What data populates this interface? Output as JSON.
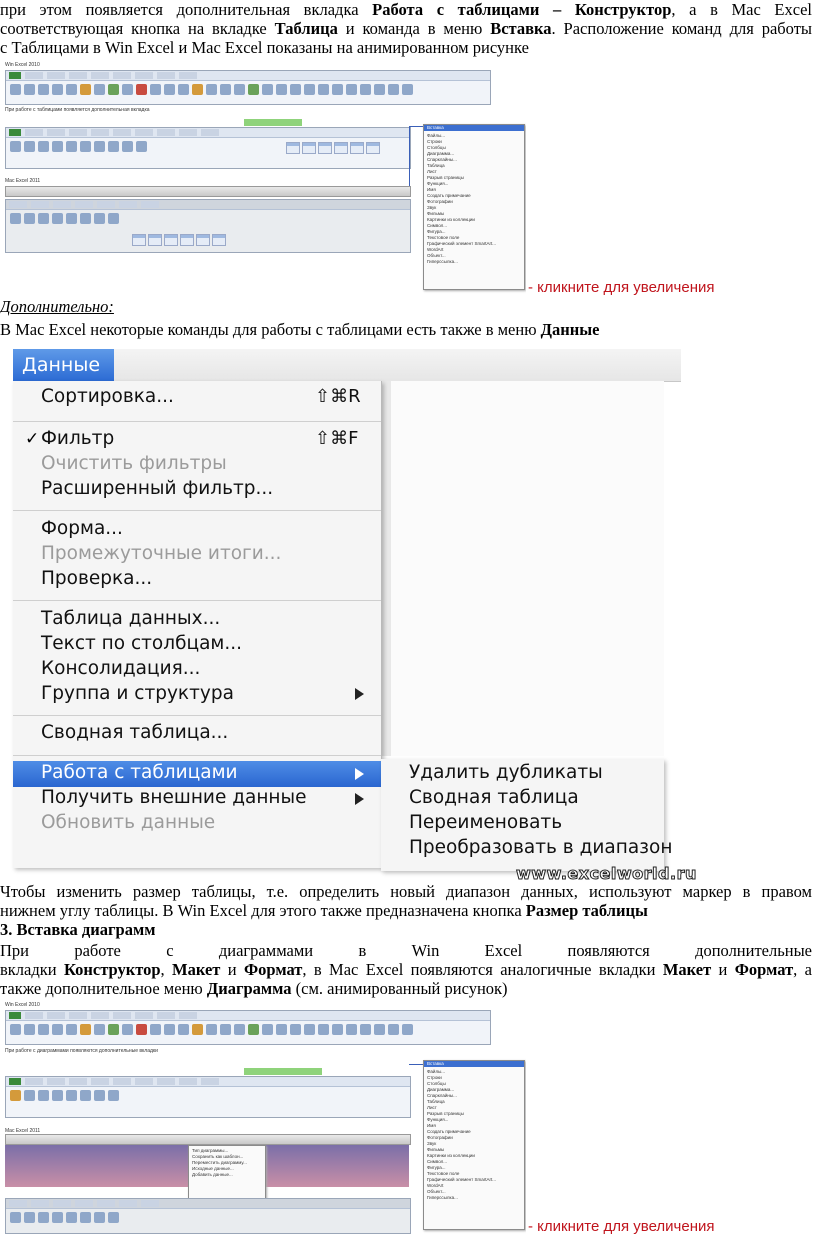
{
  "para1": {
    "line1": [
      "при этом появляется дополнительная вкладка ",
      "Работа с таблицами – Конструктор",
      ", а в Mac Excel"
    ],
    "line2": [
      "соответствующая кнопка на вкладке ",
      "Таблица",
      " и команда в меню ",
      "Вставка",
      ". Расположение команд для работы"
    ],
    "line3": "с Таблицами в Win Excel и Mac Excel показаны на анимированном рисунке"
  },
  "thumb1": {
    "win_label": "Win Excel 2010",
    "caption": "При работе с таблицами появляется дополнительная вкладка",
    "mac_label": "Mac Excel 2011",
    "mac_menu_title": "Вставка",
    "mac_menu_items": [
      "Файлы...",
      "Строки",
      "Столбцы",
      "Диаграмма...",
      "Спарклайны...",
      "Таблица",
      "Лист",
      "Разрыв страницы",
      "Функция...",
      "Имя",
      "Создать примечание",
      "Фотографии",
      "Звук",
      "Фильмы",
      "Картинки из коллекции",
      "Символ...",
      "Фигура...",
      "Текстовое поле",
      "Графический элемент SmartArt...",
      "WordArt",
      "Объект...",
      "Гиперссылка..."
    ],
    "click_link": "кликните для увеличения"
  },
  "dop_heading": "Дополнительно:",
  "para2": [
    "В Mac Excel некоторые команды для работы с таблицами есть также в меню ",
    "Данные"
  ],
  "menu": {
    "title": "Данные",
    "items": {
      "sort": "Сортировка...",
      "sort_shortcut": "⇧⌘R",
      "filter": "Фильтр",
      "filter_check": "✓",
      "filter_shortcut": "⇧⌘F",
      "clear_filters": "Очистить фильтры",
      "adv_filter": "Расширенный фильтр...",
      "form": "Форма...",
      "subtotals": "Промежуточные итоги...",
      "validation": "Проверка...",
      "data_table": "Таблица данных...",
      "text_to_columns": "Текст по столбцам...",
      "consolidate": "Консолидация...",
      "group": "Группа и структура",
      "pivot": "Сводная таблица...",
      "table_tools": "Работа с таблицами",
      "external": "Получить внешние данные",
      "refresh": "Обновить данные"
    },
    "submenu": [
      "Удалить дубликаты",
      "Сводная таблица",
      "Переименовать",
      "Преобразовать в диапазон"
    ],
    "watermark": "www.excelworld.ru"
  },
  "para3": {
    "line1": "Чтобы изменить размер таблицы, т.е. определить новый диапазон данных, используют маркер в правом",
    "line2": [
      "нижнем углу таблицы. В Win Excel для этого также предназначена кнопка ",
      "Размер таблицы"
    ]
  },
  "section3": "3. Вставка диаграмм",
  "para4": {
    "line1": "При работе с диаграммами в Win Excel появляются дополнительные",
    "line2": [
      "вкладки ",
      "Конструктор",
      ", ",
      "Макет",
      " и ",
      "Формат",
      ", в Mac Excel появляются аналогичные вкладки ",
      "Макет",
      " и ",
      "Формат",
      ", а"
    ],
    "line3": [
      "также дополнительное меню ",
      "Диаграмма",
      " (см. анимированный рисунок)"
    ]
  },
  "thumb2": {
    "win_label": "Win Excel 2010",
    "caption": "При работе с диаграммами появляются дополнительные вкладки",
    "mac_label": "Mac Excel 2011",
    "mac_menu_title": "Вставка",
    "chart_menu_items": [
      "Тип диаграммы...",
      "Сохранить как шаблон...",
      "Переместить диаграмму...",
      "Исходные данные...",
      "Добавить данные..."
    ],
    "click_link": "кликните для увеличения"
  }
}
